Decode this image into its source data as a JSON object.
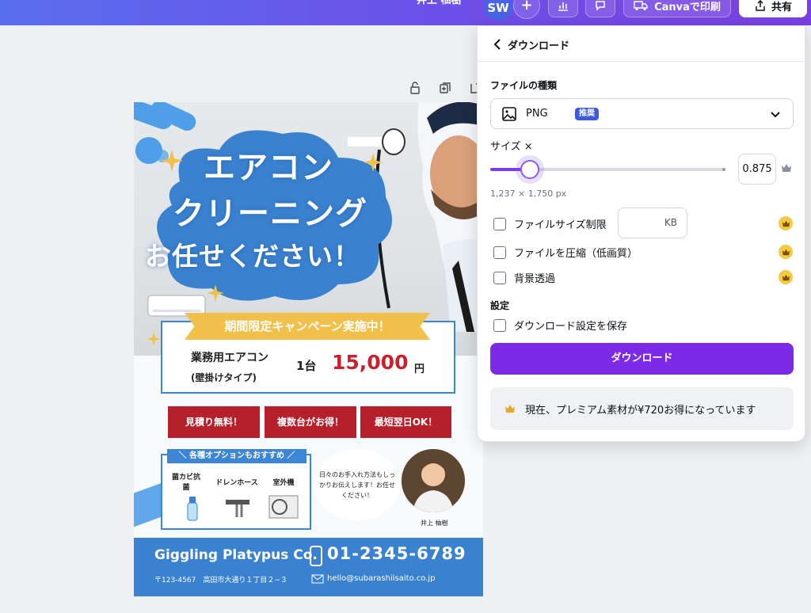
{
  "topbar": {
    "user_name": "井上 柚樹",
    "avatar_initials": "SW",
    "print_label": "Canvaで印刷",
    "share_label": "共有"
  },
  "poster": {
    "title_line1": "エアコン",
    "title_line2": "クリーニング",
    "title_line3": "お任せください！",
    "campaign": "期間限定キャンペーン実施中！",
    "service_name": "業務用エアコン",
    "service_sub": "(壁掛けタイプ)",
    "unit": "1台",
    "price": "15,000",
    "yen": "円",
    "tags": [
      "見積り無料！",
      "複数台がお得！",
      "最短翌日OK！"
    ],
    "options_head": "＼ 各種オプションもおすすめ ／",
    "options": [
      "菌カビ抗菌",
      "ドレンホース",
      "室外機"
    ],
    "speech": "日々のお手入れ方法もしっかりお伝えします！お任せください！",
    "staff_name": "井上 柚樹",
    "company": "Giggling Platypus Co.",
    "phone": "01-2345-6789",
    "address": "〒123-4567　高田市大通り１丁目２−３",
    "email": "hello@subarashiisaito.co.jp"
  },
  "download_panel": {
    "title": "ダウンロード",
    "file_type_label": "ファイルの種類",
    "file_type_value": "PNG",
    "file_type_badge": "推奨",
    "size_label": "サイズ ×",
    "size_value": "0.875",
    "size_fraction": 0.17,
    "dimensions": "1,237 × 1,750 px",
    "file_size_limit_label": "ファイルサイズ制限",
    "kb_unit": "KB",
    "compress_label": "ファイルを圧縮（低画質）",
    "transparent_label": "背景透過",
    "settings_label": "設定",
    "save_settings_label": "ダウンロード設定を保存",
    "download_button": "ダウンロード",
    "promo_text": "現在、プレミアム素材が¥720お得になっています"
  },
  "colors": {
    "accent": "#7d2ae8",
    "crown": "#f6c945",
    "poster_blue": "#3a82cf",
    "price_red": "#c8222e"
  },
  "icons": [
    "chevron-left-icon",
    "image-icon",
    "chevron-down-icon",
    "crown-icon",
    "share-icon",
    "truck-icon",
    "comment-icon",
    "chart-icon",
    "plus-icon",
    "lock-icon",
    "duplicate-icon",
    "add-page-icon"
  ]
}
